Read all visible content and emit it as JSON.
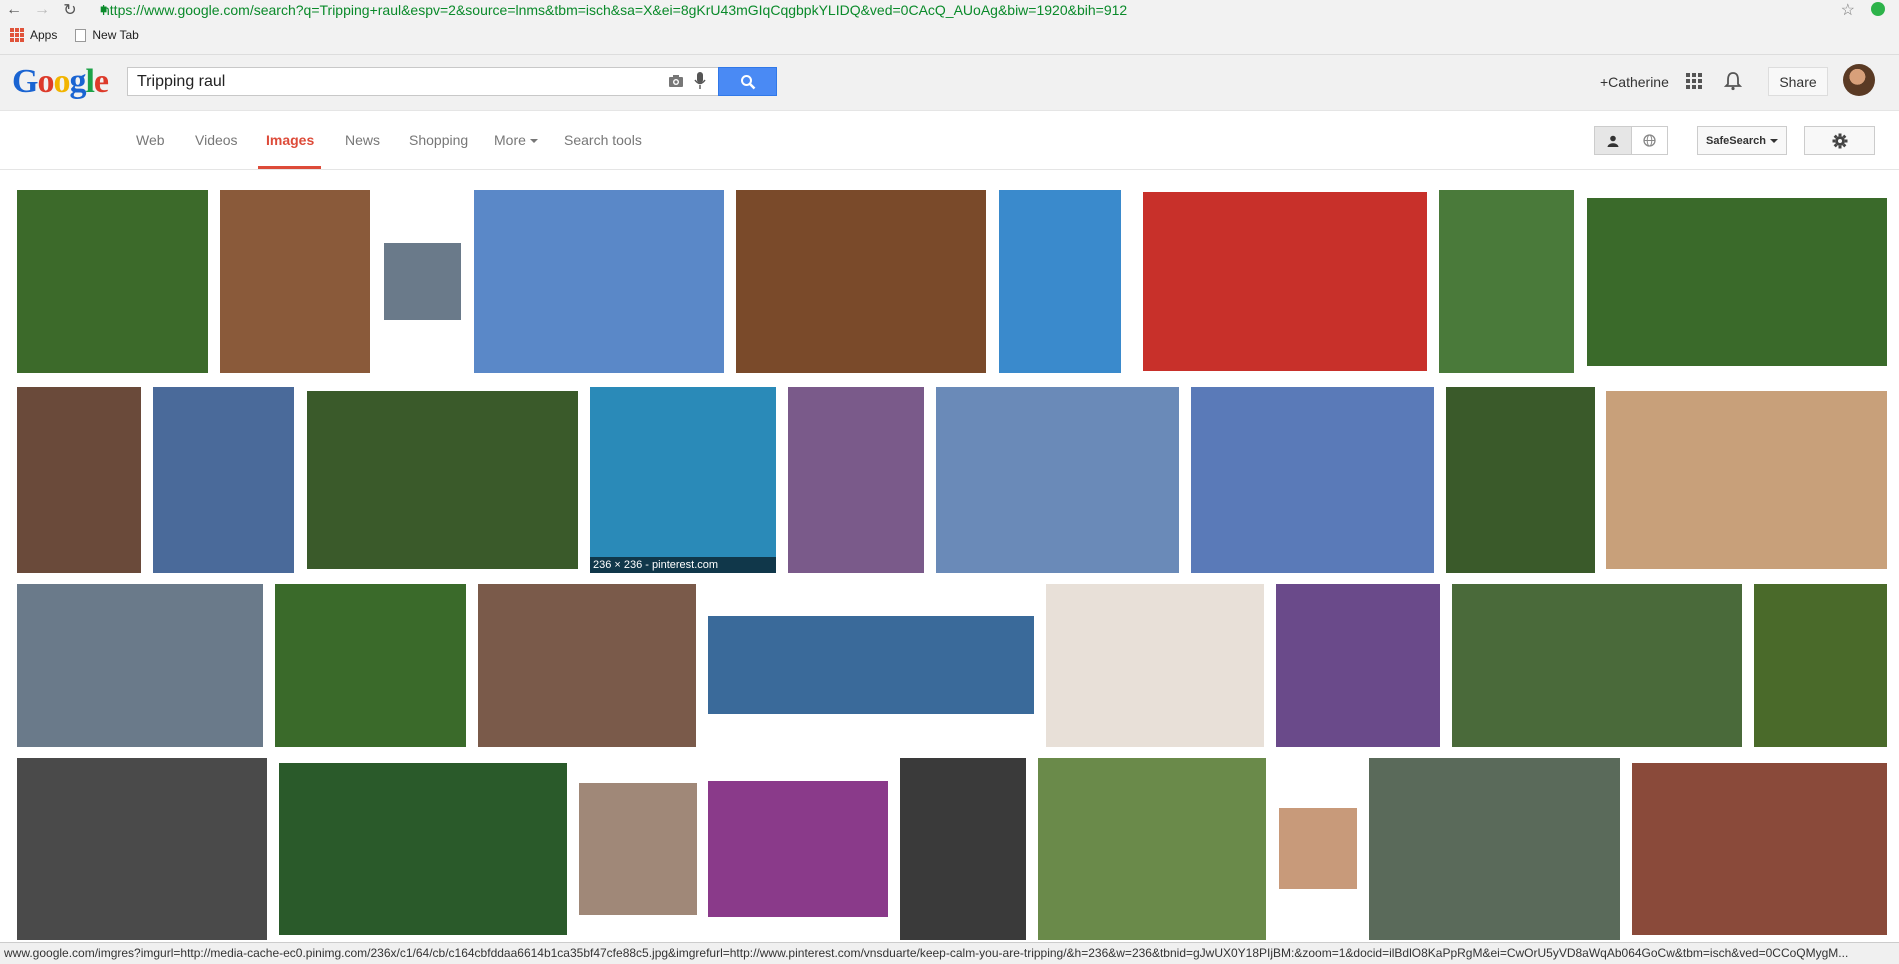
{
  "browser": {
    "url": "https://www.google.com/search?q=Tripping+raul&espv=2&source=lnms&tbm=isch&sa=X&ei=8gKrU43mGIqCqgbpkYLIDQ&ved=0CAcQ_AUoAg&biw=1920&bih=912",
    "bookmarks": [
      "Apps",
      "New Tab"
    ]
  },
  "header": {
    "logo": "Google",
    "search_query": "Tripping raul",
    "user_link": "+Catherine",
    "share_label": "Share"
  },
  "tabs": {
    "items": [
      "Web",
      "Videos",
      "Images",
      "News",
      "Shopping",
      "More",
      "Search tools"
    ],
    "active": "Images",
    "safesearch_label": "SafeSearch"
  },
  "results": {
    "caption": "236 × 236 - pinterest.com",
    "rows": [
      [
        "#3c6a2a",
        "#8a5a3a",
        "#6a7a8a",
        "#5a88c8",
        "#7a4a2a",
        "#3a8acc",
        "#c8302a",
        "#4a7a3a",
        "#3a6a2a"
      ],
      [
        "#6a4a3a",
        "#4a6a9a",
        "#3a5a2a",
        "#2a8ab8",
        "#7a5a8a",
        "#6a8ab8",
        "#5a7ab8",
        "#3a5a2a",
        "#c8a07a"
      ],
      [
        "#6a7a8a",
        "#3a6a2a",
        "#7a5a4a",
        "#3a6a9a",
        "#e8e0d8",
        "#6a4a8a",
        "#4a6a3a",
        "#4a6a2a"
      ],
      [
        "#4a4a4a",
        "#2a5a2a",
        "#a08878",
        "#8a3a8a",
        "#3a3a3a",
        "#6a8a4a",
        "#c89a7a",
        "#5a6a5a",
        "#8a4a3a"
      ]
    ]
  },
  "status": {
    "text": "www.google.com/imgres?imgurl=http://media-cache-ec0.pinimg.com/236x/c1/64/cb/c164cbfddaa6614b1ca35bf47cfe88c5.jpg&imgrefurl=http://www.pinterest.com/vnsduarte/keep-calm-you-are-tripping/&h=236&w=236&tbnid=gJwUX0Y18PIjBM:&zoom=1&docid=ilBdlO8KaPpRgM&ei=CwOrU5yVD8aWqAb064GoCw&tbm=isch&ved=0CCoQMygM..."
  }
}
